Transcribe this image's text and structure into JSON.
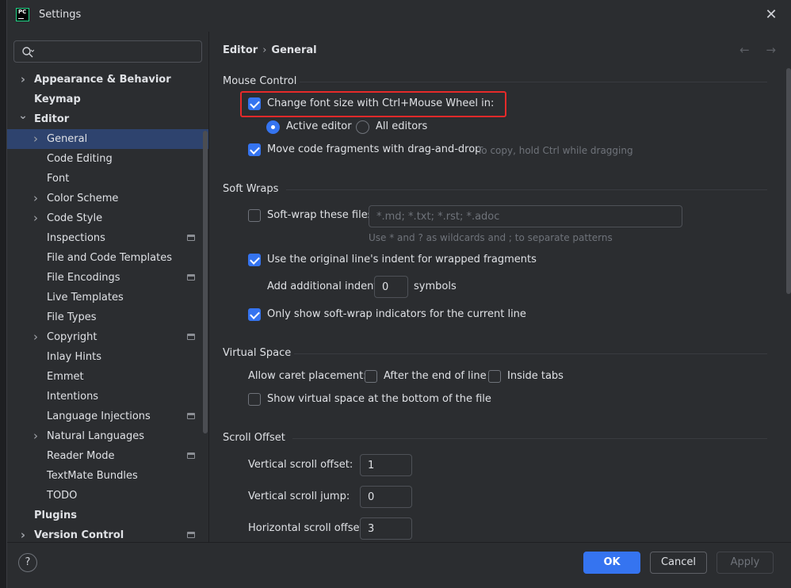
{
  "window": {
    "title": "Settings",
    "app_logo_text": "PC"
  },
  "sidebar": {
    "search_placeholder": "",
    "items": [
      {
        "label": "Appearance & Behavior",
        "level": 0,
        "bold": true,
        "chevron": "right"
      },
      {
        "label": "Keymap",
        "level": 0,
        "bold": true,
        "chevron": ""
      },
      {
        "label": "Editor",
        "level": 0,
        "bold": true,
        "chevron": "down"
      },
      {
        "label": "General",
        "level": 1,
        "bold": false,
        "chevron": "right",
        "selected": true
      },
      {
        "label": "Code Editing",
        "level": 1,
        "bold": false,
        "chevron": ""
      },
      {
        "label": "Font",
        "level": 1,
        "bold": false,
        "chevron": ""
      },
      {
        "label": "Color Scheme",
        "level": 1,
        "bold": false,
        "chevron": "right"
      },
      {
        "label": "Code Style",
        "level": 1,
        "bold": false,
        "chevron": "right"
      },
      {
        "label": "Inspections",
        "level": 1,
        "bold": false,
        "chevron": "",
        "project_icon": true
      },
      {
        "label": "File and Code Templates",
        "level": 1,
        "bold": false,
        "chevron": ""
      },
      {
        "label": "File Encodings",
        "level": 1,
        "bold": false,
        "chevron": "",
        "project_icon": true
      },
      {
        "label": "Live Templates",
        "level": 1,
        "bold": false,
        "chevron": ""
      },
      {
        "label": "File Types",
        "level": 1,
        "bold": false,
        "chevron": ""
      },
      {
        "label": "Copyright",
        "level": 1,
        "bold": false,
        "chevron": "right",
        "project_icon": true
      },
      {
        "label": "Inlay Hints",
        "level": 1,
        "bold": false,
        "chevron": ""
      },
      {
        "label": "Emmet",
        "level": 1,
        "bold": false,
        "chevron": ""
      },
      {
        "label": "Intentions",
        "level": 1,
        "bold": false,
        "chevron": ""
      },
      {
        "label": "Language Injections",
        "level": 1,
        "bold": false,
        "chevron": "",
        "project_icon": true
      },
      {
        "label": "Natural Languages",
        "level": 1,
        "bold": false,
        "chevron": "right"
      },
      {
        "label": "Reader Mode",
        "level": 1,
        "bold": false,
        "chevron": "",
        "project_icon": true
      },
      {
        "label": "TextMate Bundles",
        "level": 1,
        "bold": false,
        "chevron": ""
      },
      {
        "label": "TODO",
        "level": 1,
        "bold": false,
        "chevron": ""
      },
      {
        "label": "Plugins",
        "level": 0,
        "bold": true,
        "chevron": ""
      },
      {
        "label": "Version Control",
        "level": 0,
        "bold": true,
        "chevron": "right",
        "project_icon": true
      }
    ]
  },
  "breadcrumb": {
    "parent": "Editor",
    "separator": "›",
    "current": "General"
  },
  "nav_arrows": "← →",
  "mouse_control": {
    "title": "Mouse Control",
    "change_font_size": {
      "label": "Change font size with Ctrl+Mouse Wheel in:",
      "checked": true
    },
    "radio_active": {
      "label": "Active editor",
      "selected": true
    },
    "radio_all": {
      "label": "All editors",
      "selected": false
    },
    "move_fragments": {
      "label": "Move code fragments with drag-and-drop",
      "checked": true
    },
    "move_hint": "To copy, hold Ctrl while dragging"
  },
  "soft_wraps": {
    "title": "Soft Wraps",
    "soft_wrap_files": {
      "label": "Soft-wrap these files:",
      "checked": false
    },
    "files_placeholder": "*.md; *.txt; *.rst; *.adoc",
    "files_hint": "Use * and ? as wildcards and ; to separate patterns",
    "use_original_indent": {
      "label": "Use the original line's indent for wrapped fragments",
      "checked": true
    },
    "additional_indent_label": "Add additional indent:",
    "additional_indent_value": "0",
    "symbols_label": "symbols",
    "only_show_indicators": {
      "label": "Only show soft-wrap indicators for the current line",
      "checked": true
    }
  },
  "virtual_space": {
    "title": "Virtual Space",
    "caret_label": "Allow caret placement:",
    "after_end": {
      "label": "After the end of line",
      "checked": false
    },
    "inside_tabs": {
      "label": "Inside tabs",
      "checked": false
    },
    "show_virtual": {
      "label": "Show virtual space at the bottom of the file",
      "checked": false
    }
  },
  "scroll_offset": {
    "title": "Scroll Offset",
    "vertical_offset_label": "Vertical scroll offset:",
    "vertical_offset_value": "1",
    "vertical_jump_label": "Vertical scroll jump:",
    "vertical_jump_value": "0",
    "horizontal_offset_label": "Horizontal scroll offset:",
    "horizontal_offset_value": "3"
  },
  "footer": {
    "help": "?",
    "ok": "OK",
    "cancel": "Cancel",
    "apply": "Apply"
  },
  "colors": {
    "accent": "#3574f0",
    "selection": "#2e436e",
    "highlight_box": "#e62a2a",
    "background": "#2b2d30"
  }
}
